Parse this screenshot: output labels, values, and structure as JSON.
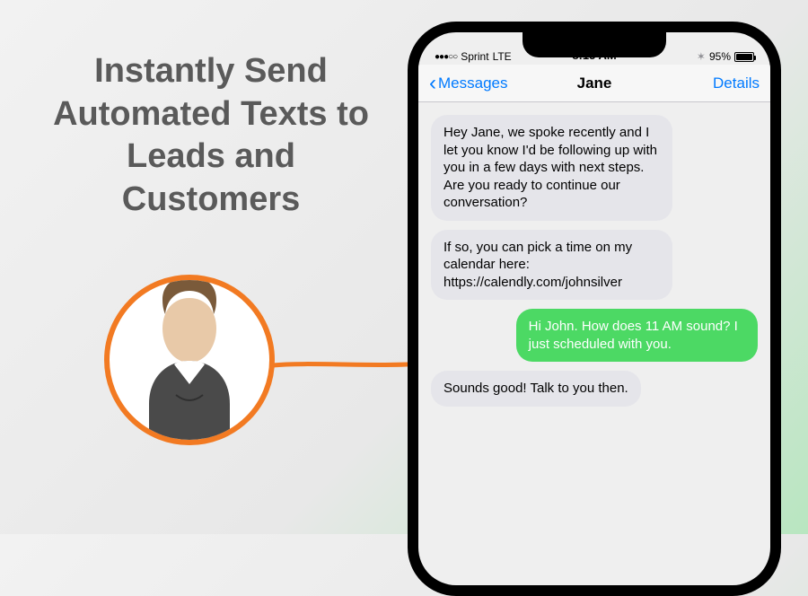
{
  "headline": "Instantly Send Automated Texts to Leads and Customers",
  "statusBar": {
    "carrier": "Sprint",
    "network": "LTE",
    "time": "8:15 AM",
    "batteryPct": "95%"
  },
  "nav": {
    "backLabel": "Messages",
    "title": "Jane",
    "details": "Details"
  },
  "messages": [
    {
      "direction": "incoming",
      "text": "Hey Jane, we spoke recently and I let you know I'd be following up with you in a few days with next steps. Are you ready to continue our conversation?"
    },
    {
      "direction": "incoming",
      "text": "If so, you can pick a time on my calendar here: https://calendly.com/johnsilver"
    },
    {
      "direction": "outgoing",
      "text": "Hi John. How does 11 AM sound? I just scheduled with you."
    },
    {
      "direction": "incoming",
      "text": "Sounds good! Talk to you then."
    }
  ],
  "colors": {
    "accentOrange": "#f27a22",
    "iosBlue": "#007aff",
    "outgoingGreen": "#4cd964",
    "incomingGray": "#e5e5ea"
  }
}
